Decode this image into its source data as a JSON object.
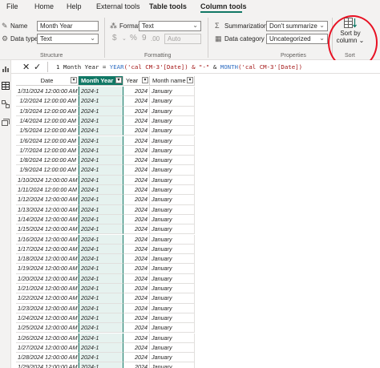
{
  "menu": {
    "items": [
      {
        "label": "File",
        "active": false
      },
      {
        "label": "Home",
        "active": false
      },
      {
        "label": "Help",
        "active": false
      },
      {
        "label": "External tools",
        "active": false
      },
      {
        "label": "Table tools",
        "active": true
      },
      {
        "label": "Column tools",
        "active": true
      }
    ]
  },
  "ribbon": {
    "structure": {
      "name_label": "Name",
      "name_value": "Month Year",
      "datatype_label": "Data type",
      "datatype_value": "Text",
      "group_label": "Structure"
    },
    "formatting": {
      "format_label": "Format",
      "format_value": "Text",
      "currency_symbol": "$",
      "percent_symbol": "%",
      "comma_symbol": "9",
      "decimal_symbol": ".00",
      "auto_value": "Auto",
      "group_label": "Formatting"
    },
    "properties": {
      "summarization_label": "Summarization",
      "summarization_value": "Don't summarize",
      "category_label": "Data category",
      "category_value": "Uncategorized",
      "group_label": "Properties"
    },
    "sort": {
      "button_label_1": "Sort by",
      "button_label_2": "column",
      "group_label": "Sort"
    }
  },
  "formula_bar": {
    "line_number": "1",
    "formula_prefix": "Month Year = ",
    "fn_year": "YEAR",
    "arg_1": "('cal CM-3'[Date]) & ",
    "sep_string": "\"-\"",
    "concat": " & ",
    "fn_month": "MONTH",
    "arg_2": "('cal CM-3'[Date])"
  },
  "table": {
    "columns": [
      "Date",
      "Month Year",
      "Year",
      "Month name"
    ],
    "selected_column": "Month Year",
    "rows": [
      [
        "1/31/2024 12:00:00 AM",
        "2024-1",
        "2024",
        "January"
      ],
      [
        "1/2/2024 12:00:00 AM",
        "2024-1",
        "2024",
        "January"
      ],
      [
        "1/3/2024 12:00:00 AM",
        "2024-1",
        "2024",
        "January"
      ],
      [
        "1/4/2024 12:00:00 AM",
        "2024-1",
        "2024",
        "January"
      ],
      [
        "1/5/2024 12:00:00 AM",
        "2024-1",
        "2024",
        "January"
      ],
      [
        "1/6/2024 12:00:00 AM",
        "2024-1",
        "2024",
        "January"
      ],
      [
        "1/7/2024 12:00:00 AM",
        "2024-1",
        "2024",
        "January"
      ],
      [
        "1/8/2024 12:00:00 AM",
        "2024-1",
        "2024",
        "January"
      ],
      [
        "1/9/2024 12:00:00 AM",
        "2024-1",
        "2024",
        "January"
      ],
      [
        "1/10/2024 12:00:00 AM",
        "2024-1",
        "2024",
        "January"
      ],
      [
        "1/11/2024 12:00:00 AM",
        "2024-1",
        "2024",
        "January"
      ],
      [
        "1/12/2024 12:00:00 AM",
        "2024-1",
        "2024",
        "January"
      ],
      [
        "1/13/2024 12:00:00 AM",
        "2024-1",
        "2024",
        "January"
      ],
      [
        "1/14/2024 12:00:00 AM",
        "2024-1",
        "2024",
        "January"
      ],
      [
        "1/15/2024 12:00:00 AM",
        "2024-1",
        "2024",
        "January"
      ],
      [
        "1/16/2024 12:00:00 AM",
        "2024-1",
        "2024",
        "January"
      ],
      [
        "1/17/2024 12:00:00 AM",
        "2024-1",
        "2024",
        "January"
      ],
      [
        "1/18/2024 12:00:00 AM",
        "2024-1",
        "2024",
        "January"
      ],
      [
        "1/19/2024 12:00:00 AM",
        "2024-1",
        "2024",
        "January"
      ],
      [
        "1/20/2024 12:00:00 AM",
        "2024-1",
        "2024",
        "January"
      ],
      [
        "1/21/2024 12:00:00 AM",
        "2024-1",
        "2024",
        "January"
      ],
      [
        "1/22/2024 12:00:00 AM",
        "2024-1",
        "2024",
        "January"
      ],
      [
        "1/23/2024 12:00:00 AM",
        "2024-1",
        "2024",
        "January"
      ],
      [
        "1/24/2024 12:00:00 AM",
        "2024-1",
        "2024",
        "January"
      ],
      [
        "1/25/2024 12:00:00 AM",
        "2024-1",
        "2024",
        "January"
      ],
      [
        "1/26/2024 12:00:00 AM",
        "2024-1",
        "2024",
        "January"
      ],
      [
        "1/27/2024 12:00:00 AM",
        "2024-1",
        "2024",
        "January"
      ],
      [
        "1/28/2024 12:00:00 AM",
        "2024-1",
        "2024",
        "January"
      ],
      [
        "1/29/2024 12:00:00 AM",
        "2024-1",
        "2024",
        "January"
      ]
    ]
  },
  "colors": {
    "accent": "#117865",
    "annotation": "#e81123"
  },
  "icons": {
    "rail": [
      "report-view-icon",
      "table-view-icon",
      "model-view-icon",
      "dax-query-icon"
    ]
  }
}
